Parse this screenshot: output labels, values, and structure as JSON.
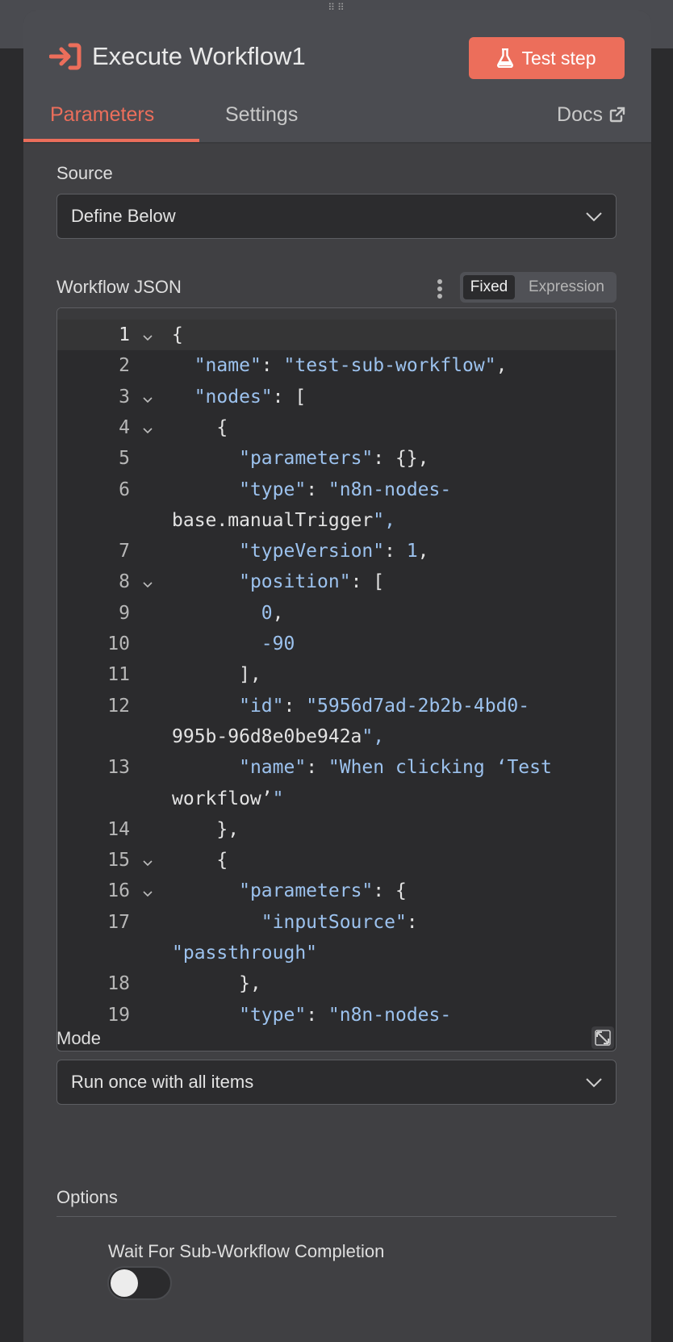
{
  "node": {
    "title": "Execute Workflow1",
    "test_button": "Test step",
    "accent_color": "#ec6e5b"
  },
  "tabs": [
    {
      "label": "Parameters",
      "active": true
    },
    {
      "label": "Settings",
      "active": false
    },
    {
      "label": "Docs",
      "active": false
    }
  ],
  "source": {
    "label": "Source",
    "value": "Define Below"
  },
  "workflow_json": {
    "label": "Workflow JSON",
    "mode_fixed": "Fixed",
    "mode_expression": "Expression",
    "lines": [
      {
        "n": "1",
        "fold": true,
        "text": "{"
      },
      {
        "n": "2",
        "fold": false,
        "text": "  \"name\": \"test-sub-workflow\","
      },
      {
        "n": "3",
        "fold": true,
        "text": "  \"nodes\": ["
      },
      {
        "n": "4",
        "fold": true,
        "text": "    {"
      },
      {
        "n": "5",
        "fold": false,
        "text": "      \"parameters\": {},"
      },
      {
        "n": "6",
        "fold": false,
        "text": "      \"type\": \"n8n-nodes-"
      },
      {
        "n": "",
        "fold": false,
        "text": "base.manualTrigger\","
      },
      {
        "n": "7",
        "fold": false,
        "text": "      \"typeVersion\": 1,"
      },
      {
        "n": "8",
        "fold": true,
        "text": "      \"position\": ["
      },
      {
        "n": "9",
        "fold": false,
        "text": "        0,"
      },
      {
        "n": "10",
        "fold": false,
        "text": "        -90"
      },
      {
        "n": "11",
        "fold": false,
        "text": "      ],"
      },
      {
        "n": "12",
        "fold": false,
        "text": "      \"id\": \"5956d7ad-2b2b-4bd0-"
      },
      {
        "n": "",
        "fold": false,
        "text": "995b-96d8e0be942a\","
      },
      {
        "n": "13",
        "fold": false,
        "text": "      \"name\": \"When clicking ‘Test"
      },
      {
        "n": "",
        "fold": false,
        "text": "workflow’\""
      },
      {
        "n": "14",
        "fold": false,
        "text": "    },"
      },
      {
        "n": "15",
        "fold": true,
        "text": "    {"
      },
      {
        "n": "16",
        "fold": true,
        "text": "      \"parameters\": {"
      },
      {
        "n": "17",
        "fold": false,
        "text": "        \"inputSource\":"
      },
      {
        "n": "",
        "fold": false,
        "text": "\"passthrough\""
      },
      {
        "n": "18",
        "fold": false,
        "text": "      },"
      },
      {
        "n": "19",
        "fold": false,
        "text": "      \"type\": \"n8n-nodes-"
      }
    ]
  },
  "mode": {
    "label": "Mode",
    "value": "Run once with all items"
  },
  "options": {
    "label": "Options",
    "wait_label": "Wait For Sub-Workflow Completion",
    "wait_enabled": false
  }
}
